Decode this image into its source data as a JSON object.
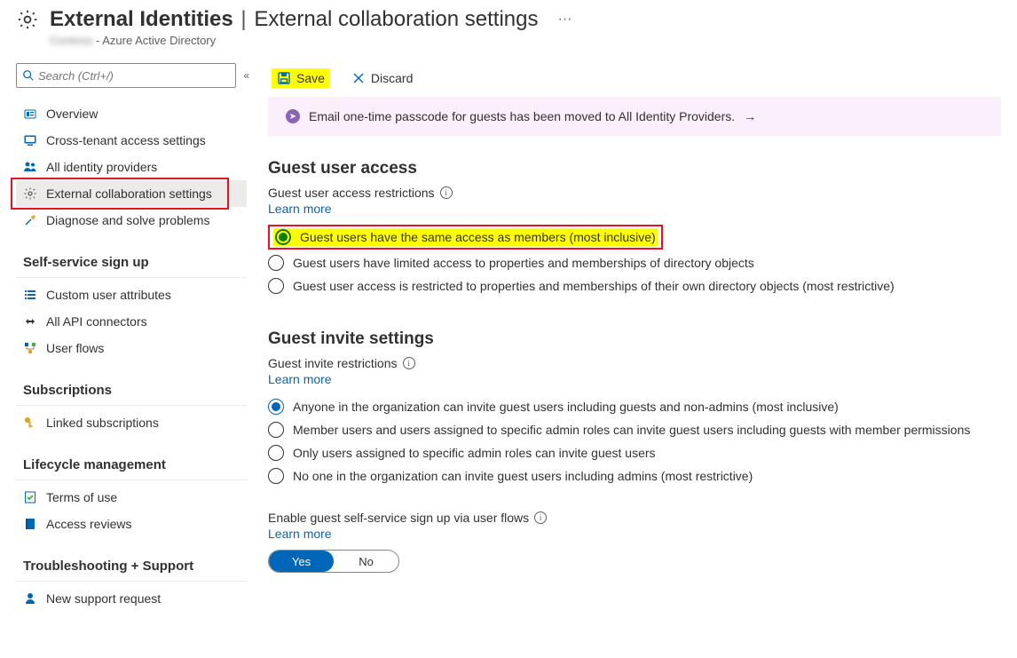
{
  "header": {
    "title_left": "External Identities",
    "title_sep": "|",
    "title_right": "External collaboration settings",
    "tenant_blur": "Contoso",
    "tenant_suffix": " - Azure Active Directory"
  },
  "search": {
    "placeholder": "Search (Ctrl+/)"
  },
  "sidebar": {
    "overview": "Overview",
    "cross_tenant": "Cross-tenant access settings",
    "idp": "All identity providers",
    "ext_collab": "External collaboration settings",
    "diagnose": "Diagnose and solve problems",
    "group_self": "Self-service sign up",
    "custom_attr": "Custom user attributes",
    "api_conn": "All API connectors",
    "user_flows": "User flows",
    "group_subs": "Subscriptions",
    "linked_subs": "Linked subscriptions",
    "group_life": "Lifecycle management",
    "terms": "Terms of use",
    "access_rev": "Access reviews",
    "group_trouble": "Troubleshooting + Support",
    "support": "New support request"
  },
  "toolbar": {
    "save": "Save",
    "discard": "Discard"
  },
  "banner": {
    "text": "Email one-time passcode for guests has been moved to All Identity Providers."
  },
  "guest_access": {
    "heading": "Guest user access",
    "label": "Guest user access restrictions",
    "learn": "Learn more",
    "opt1": "Guest users have the same access as members (most inclusive)",
    "opt2": "Guest users have limited access to properties and memberships of directory objects",
    "opt3": "Guest user access is restricted to properties and memberships of their own directory objects (most restrictive)"
  },
  "guest_invite": {
    "heading": "Guest invite settings",
    "label": "Guest invite restrictions",
    "learn": "Learn more",
    "opt1": "Anyone in the organization can invite guest users including guests and non-admins (most inclusive)",
    "opt2": "Member users and users assigned to specific admin roles can invite guest users including guests with member permissions",
    "opt3": "Only users assigned to specific admin roles can invite guest users",
    "opt4": "No one in the organization can invite guest users including admins (most restrictive)"
  },
  "self_service": {
    "label": "Enable guest self-service sign up via user flows",
    "learn": "Learn more",
    "yes": "Yes",
    "no": "No"
  }
}
